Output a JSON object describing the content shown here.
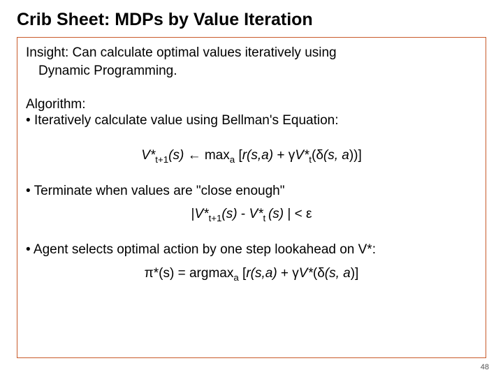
{
  "title": "Crib Sheet: MDPs by Value Iteration",
  "insight_line1": "Insight: Can calculate optimal values iteratively using",
  "insight_line2": "Dynamic Programming.",
  "algorithm_label": "Algorithm:",
  "bullet1": "Iteratively calculate value using Bellman's Equation:",
  "eq1": {
    "lhs_V": "V*",
    "lhs_sub": "t+1",
    "lhs_arg": "(s)",
    "arrow": "←",
    "max": "max",
    "max_sub": "a",
    "open": " [",
    "r": "r(s,a)",
    "plus": " + ",
    "gamma": "γ",
    "V2": "V*",
    "V2_sub": "t",
    "delta": "(δ",
    "args": "(s, a",
    "close": "))]"
  },
  "bullet2": "Terminate when values are \"close enough\"",
  "eq2": {
    "bar1": "|",
    "V1": "V*",
    "V1_sub": "t+1",
    "V1_arg": "(s)",
    "minus": " - ",
    "V2": "V*",
    "V2_sub": "t ",
    "V2_arg": "(s)",
    "bar2": " | < ",
    "eps": "ε"
  },
  "bullet3": "Agent selects optimal action by one step lookahead on V*:",
  "eq3": {
    "pi": "π*(s)",
    "eq": " = argmax",
    "sub": "a",
    "open": " [",
    "r": "r(s,a)",
    "plus": " + ",
    "gamma": "γ",
    "V": "V*",
    "delta": "(δ",
    "args": "(s, a",
    "close": ")]"
  },
  "page_number": "48"
}
